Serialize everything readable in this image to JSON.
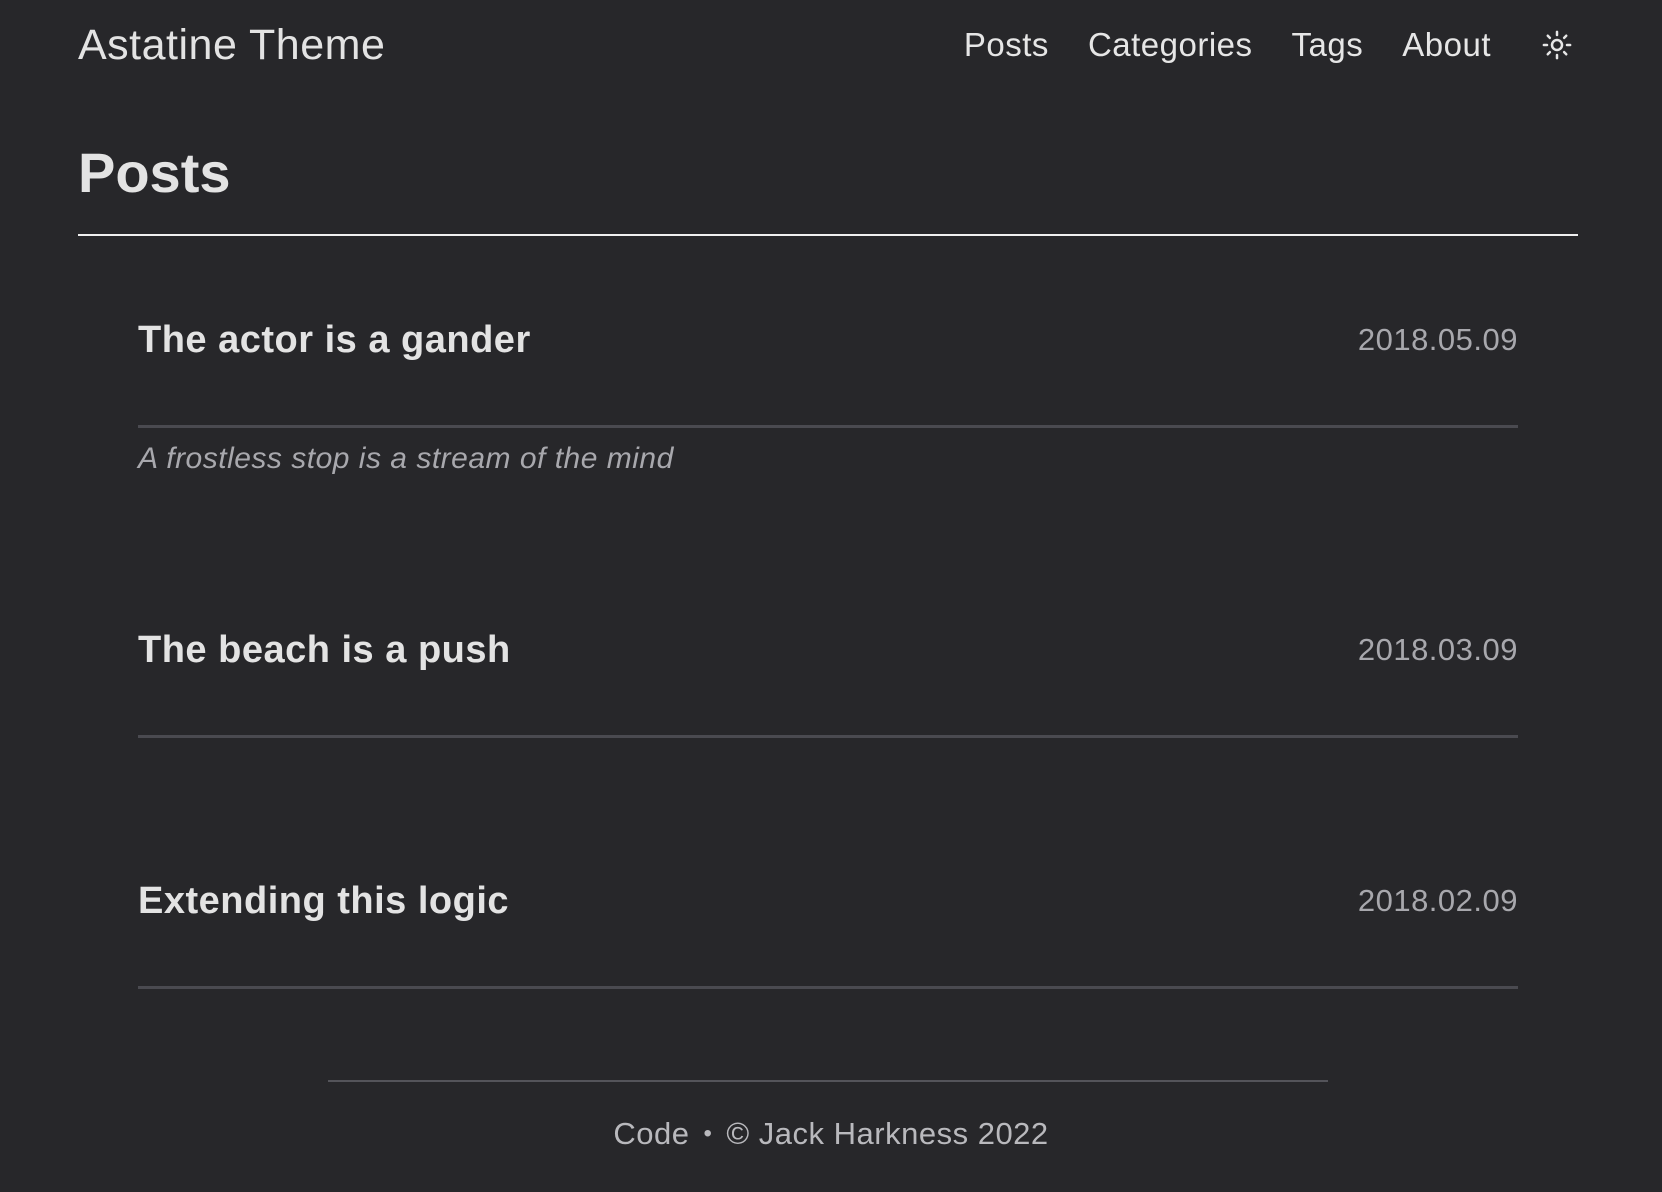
{
  "header": {
    "site_title": "Astatine Theme",
    "nav": [
      {
        "label": "Posts"
      },
      {
        "label": "Categories"
      },
      {
        "label": "Tags"
      },
      {
        "label": "About"
      }
    ],
    "theme_toggle_icon": "sun-icon"
  },
  "main": {
    "page_title": "Posts",
    "posts": [
      {
        "title": "The actor is a gander",
        "date": "2018.05.09",
        "summary": "A frostless stop is a stream of the mind"
      },
      {
        "title": "The beach is a push",
        "date": "2018.03.09",
        "summary": ""
      },
      {
        "title": "Extending this logic",
        "date": "2018.02.09",
        "summary": ""
      }
    ]
  },
  "footer": {
    "code_link": "Code",
    "separator": "•",
    "copyright": "© Jack Harkness 2022"
  },
  "colors": {
    "background": "#27272a",
    "text": "#e3e3e3",
    "muted": "#a8a8ad",
    "divider": "#4a4a50"
  }
}
